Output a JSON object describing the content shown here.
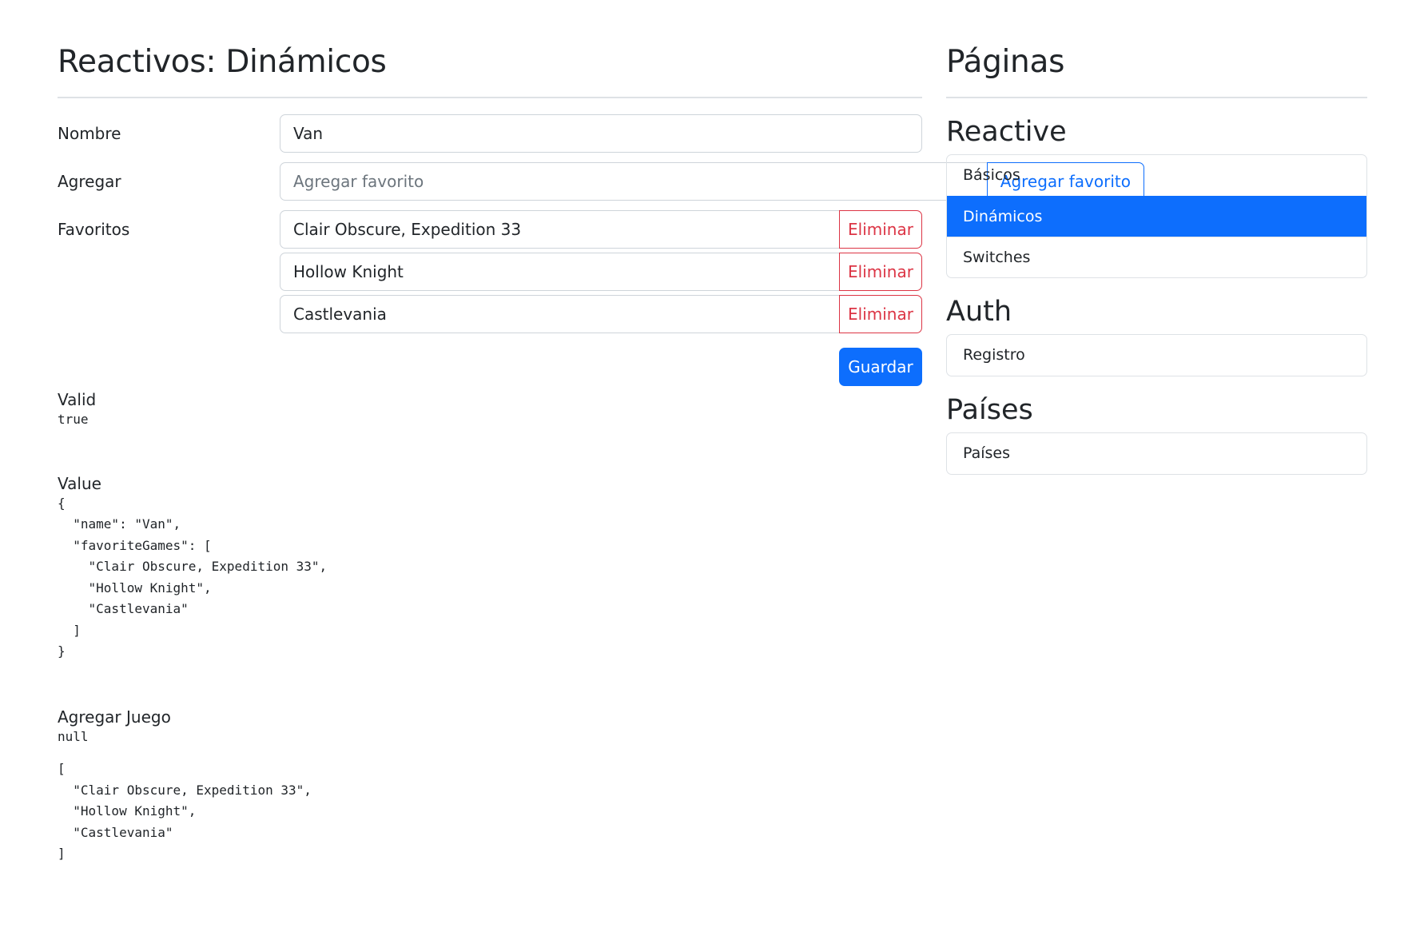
{
  "header": {
    "title_bold": "Reactivos:",
    "title_light": "Dinámicos"
  },
  "form": {
    "name_label": "Nombre",
    "name_value": "Van",
    "add_label": "Agregar",
    "add_placeholder": "Agregar favorito",
    "add_button": "Agregar favorito",
    "favorites_label": "Favoritos",
    "favorites": [
      {
        "value": "Clair Obscure, Expedition 33",
        "delete_label": "Eliminar"
      },
      {
        "value": "Hollow Knight",
        "delete_label": "Eliminar"
      },
      {
        "value": "Castlevania",
        "delete_label": "Eliminar"
      }
    ],
    "save_button": "Guardar"
  },
  "debug": {
    "valid_label": "Valid",
    "valid_value": "true",
    "value_label": "Value",
    "value_json": "{\n  \"name\": \"Van\",\n  \"favoriteGames\": [\n    \"Clair Obscure, Expedition 33\",\n    \"Hollow Knight\",\n    \"Castlevania\"\n  ]\n}",
    "add_game_label": "Agregar Juego",
    "add_game_value": "null",
    "games_json": "[\n  \"Clair Obscure, Expedition 33\",\n  \"Hollow Knight\",\n  \"Castlevania\"\n]"
  },
  "sidebar": {
    "title": "Páginas",
    "sections": [
      {
        "title": "Reactive",
        "items": [
          {
            "label": "Básicos",
            "active": false
          },
          {
            "label": "Dinámicos",
            "active": true
          },
          {
            "label": "Switches",
            "active": false
          }
        ]
      },
      {
        "title": "Auth",
        "items": [
          {
            "label": "Registro",
            "active": false
          }
        ]
      },
      {
        "title": "Países",
        "items": [
          {
            "label": "Países",
            "active": false
          }
        ]
      }
    ]
  },
  "colors": {
    "primary": "#0d6efd",
    "danger": "#dc3545",
    "border": "#dee2e6",
    "text": "#212529",
    "placeholder": "#6c757d"
  }
}
